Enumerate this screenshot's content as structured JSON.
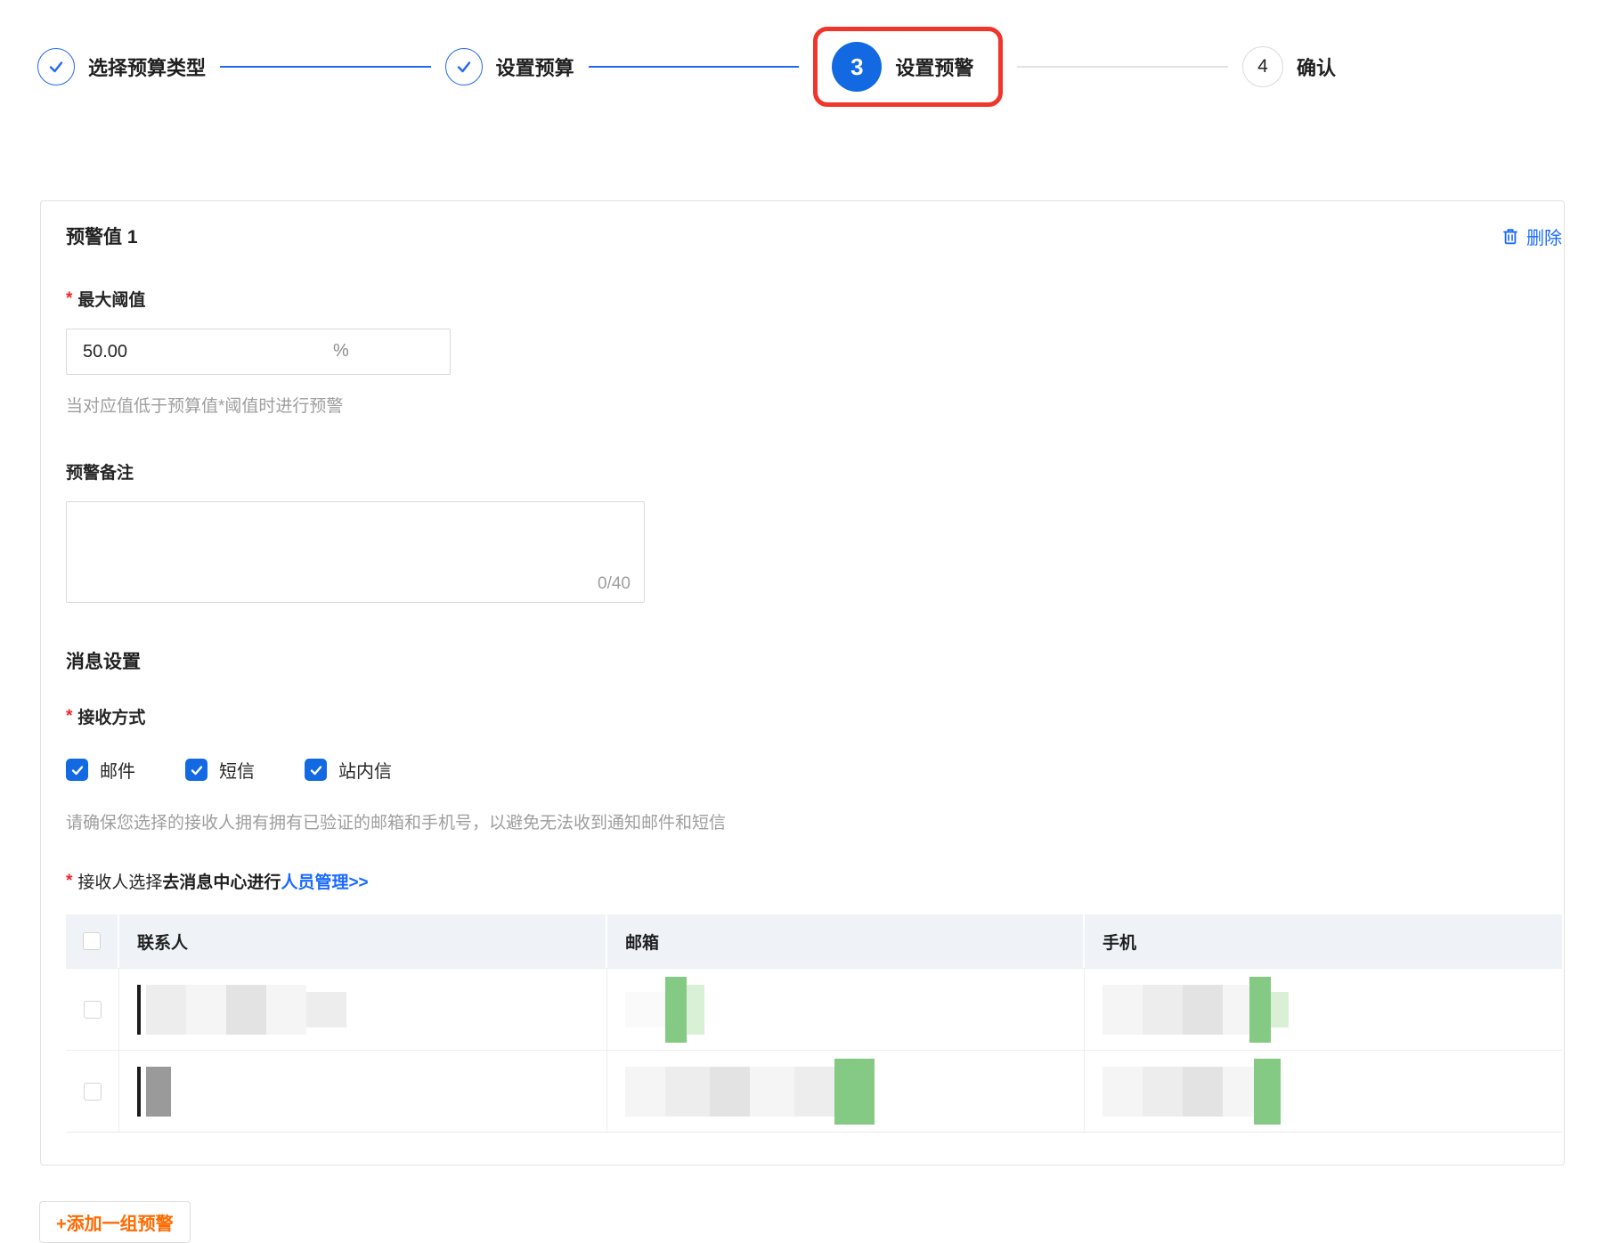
{
  "colors": {
    "accent_blue": "#1269e2",
    "link_blue": "#1a6aff",
    "danger_red": "#f5222d",
    "annotation_red": "#f0352b",
    "orange": "#ff6a00",
    "table_header_bg": "#eff3f8"
  },
  "stepper": {
    "steps": [
      {
        "number": "1",
        "label": "选择预算类型",
        "state": "done"
      },
      {
        "number": "2",
        "label": "设置预算",
        "state": "done"
      },
      {
        "number": "3",
        "label": "设置预警",
        "state": "current",
        "annotated": true
      },
      {
        "number": "4",
        "label": "确认",
        "state": "pending"
      }
    ]
  },
  "panel": {
    "title": "预警值 1",
    "delete_label": "删除",
    "threshold_label": "最大阈值",
    "threshold_value": "50.00",
    "threshold_unit": "%",
    "threshold_hint": "当对应值低于预算值*阈值时进行预警",
    "remark_label": "预警备注",
    "remark_value": "",
    "remark_counter": "0/40",
    "message_title": "消息设置",
    "receive_label": "接收方式",
    "receive_options": [
      {
        "label": "邮件",
        "checked": true
      },
      {
        "label": "短信",
        "checked": true
      },
      {
        "label": "站内信",
        "checked": true
      }
    ],
    "receive_note": "请确保您选择的接收人拥有拥有已验证的邮箱和手机号，以避免无法收到通知邮件和短信",
    "recipient_label": "接收人选择",
    "recipient_prefix": "去消息中心进行",
    "recipient_link": "人员管理>>",
    "table": {
      "columns": [
        "联系人",
        "邮箱",
        "手机"
      ],
      "rows_redacted": 2
    }
  },
  "add_alert_button": "+添加一组预警"
}
